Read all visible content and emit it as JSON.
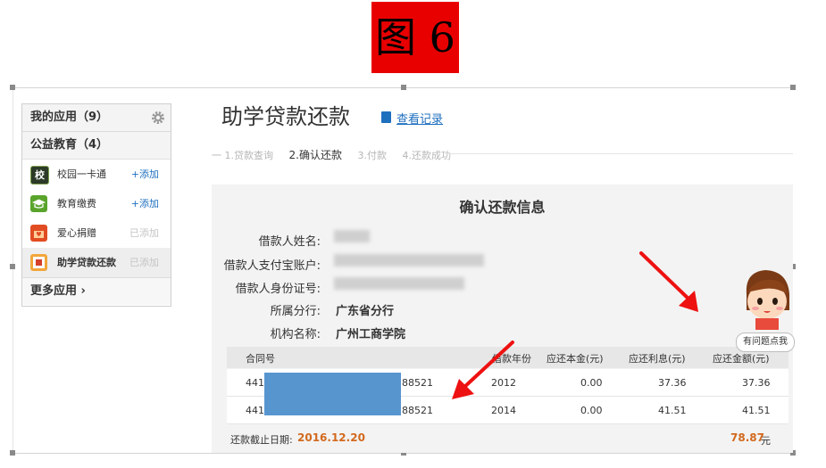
{
  "figure_label": "图 6",
  "sidebar": {
    "my_apps": "我的应用（9）",
    "section": "公益教育（4）",
    "items": [
      {
        "icon_text": "校",
        "label": "校园一卡通",
        "action": "+添加"
      },
      {
        "icon_text": "",
        "label": "教育缴费",
        "action": "+添加"
      },
      {
        "icon_text": "",
        "label": "爱心捐赠",
        "action": "已添加"
      },
      {
        "icon_text": "",
        "label": "助学贷款还款",
        "action": "已添加"
      }
    ],
    "more": "更多应用 ›"
  },
  "header": {
    "title": "助学贷款还款",
    "record_link": "查看记录"
  },
  "steps": [
    "一 1.贷款查询",
    "2.确认还款",
    "3.付款",
    "4.还款成功"
  ],
  "panel": {
    "title": "确认还款信息",
    "fields": [
      {
        "label": "借款人姓名:",
        "value": ""
      },
      {
        "label": "借款人支付宝账户:",
        "value": ""
      },
      {
        "label": "借款人身份证号:",
        "value": ""
      },
      {
        "label": "所属分行:",
        "value": "广东省分行"
      },
      {
        "label": "机构名称:",
        "value": "广州工商学院"
      }
    ]
  },
  "table": {
    "columns": [
      "合同号",
      "借款年份",
      "应还本金(元)",
      "应还利息(元)",
      "应还金额(元)"
    ],
    "rows": [
      {
        "contract_prefix": "441",
        "contract_suffix": "88521",
        "year": "2012",
        "principal": "0.00",
        "interest": "37.36",
        "amount": "37.36"
      },
      {
        "contract_prefix": "441",
        "contract_suffix": "88521",
        "year": "2014",
        "principal": "0.00",
        "interest": "41.51",
        "amount": "41.51"
      }
    ]
  },
  "footer": {
    "deadline_label": "还款截止日期:",
    "deadline": "2016.12.20",
    "total": "78.87",
    "unit": "元"
  },
  "help": {
    "text": "有问题点我"
  },
  "colors": {
    "figure_bg": "#e80000",
    "link": "#1f6fbf",
    "accent": "#d2691e",
    "redaction": "#5795cf",
    "arrow": "#ee1111"
  }
}
